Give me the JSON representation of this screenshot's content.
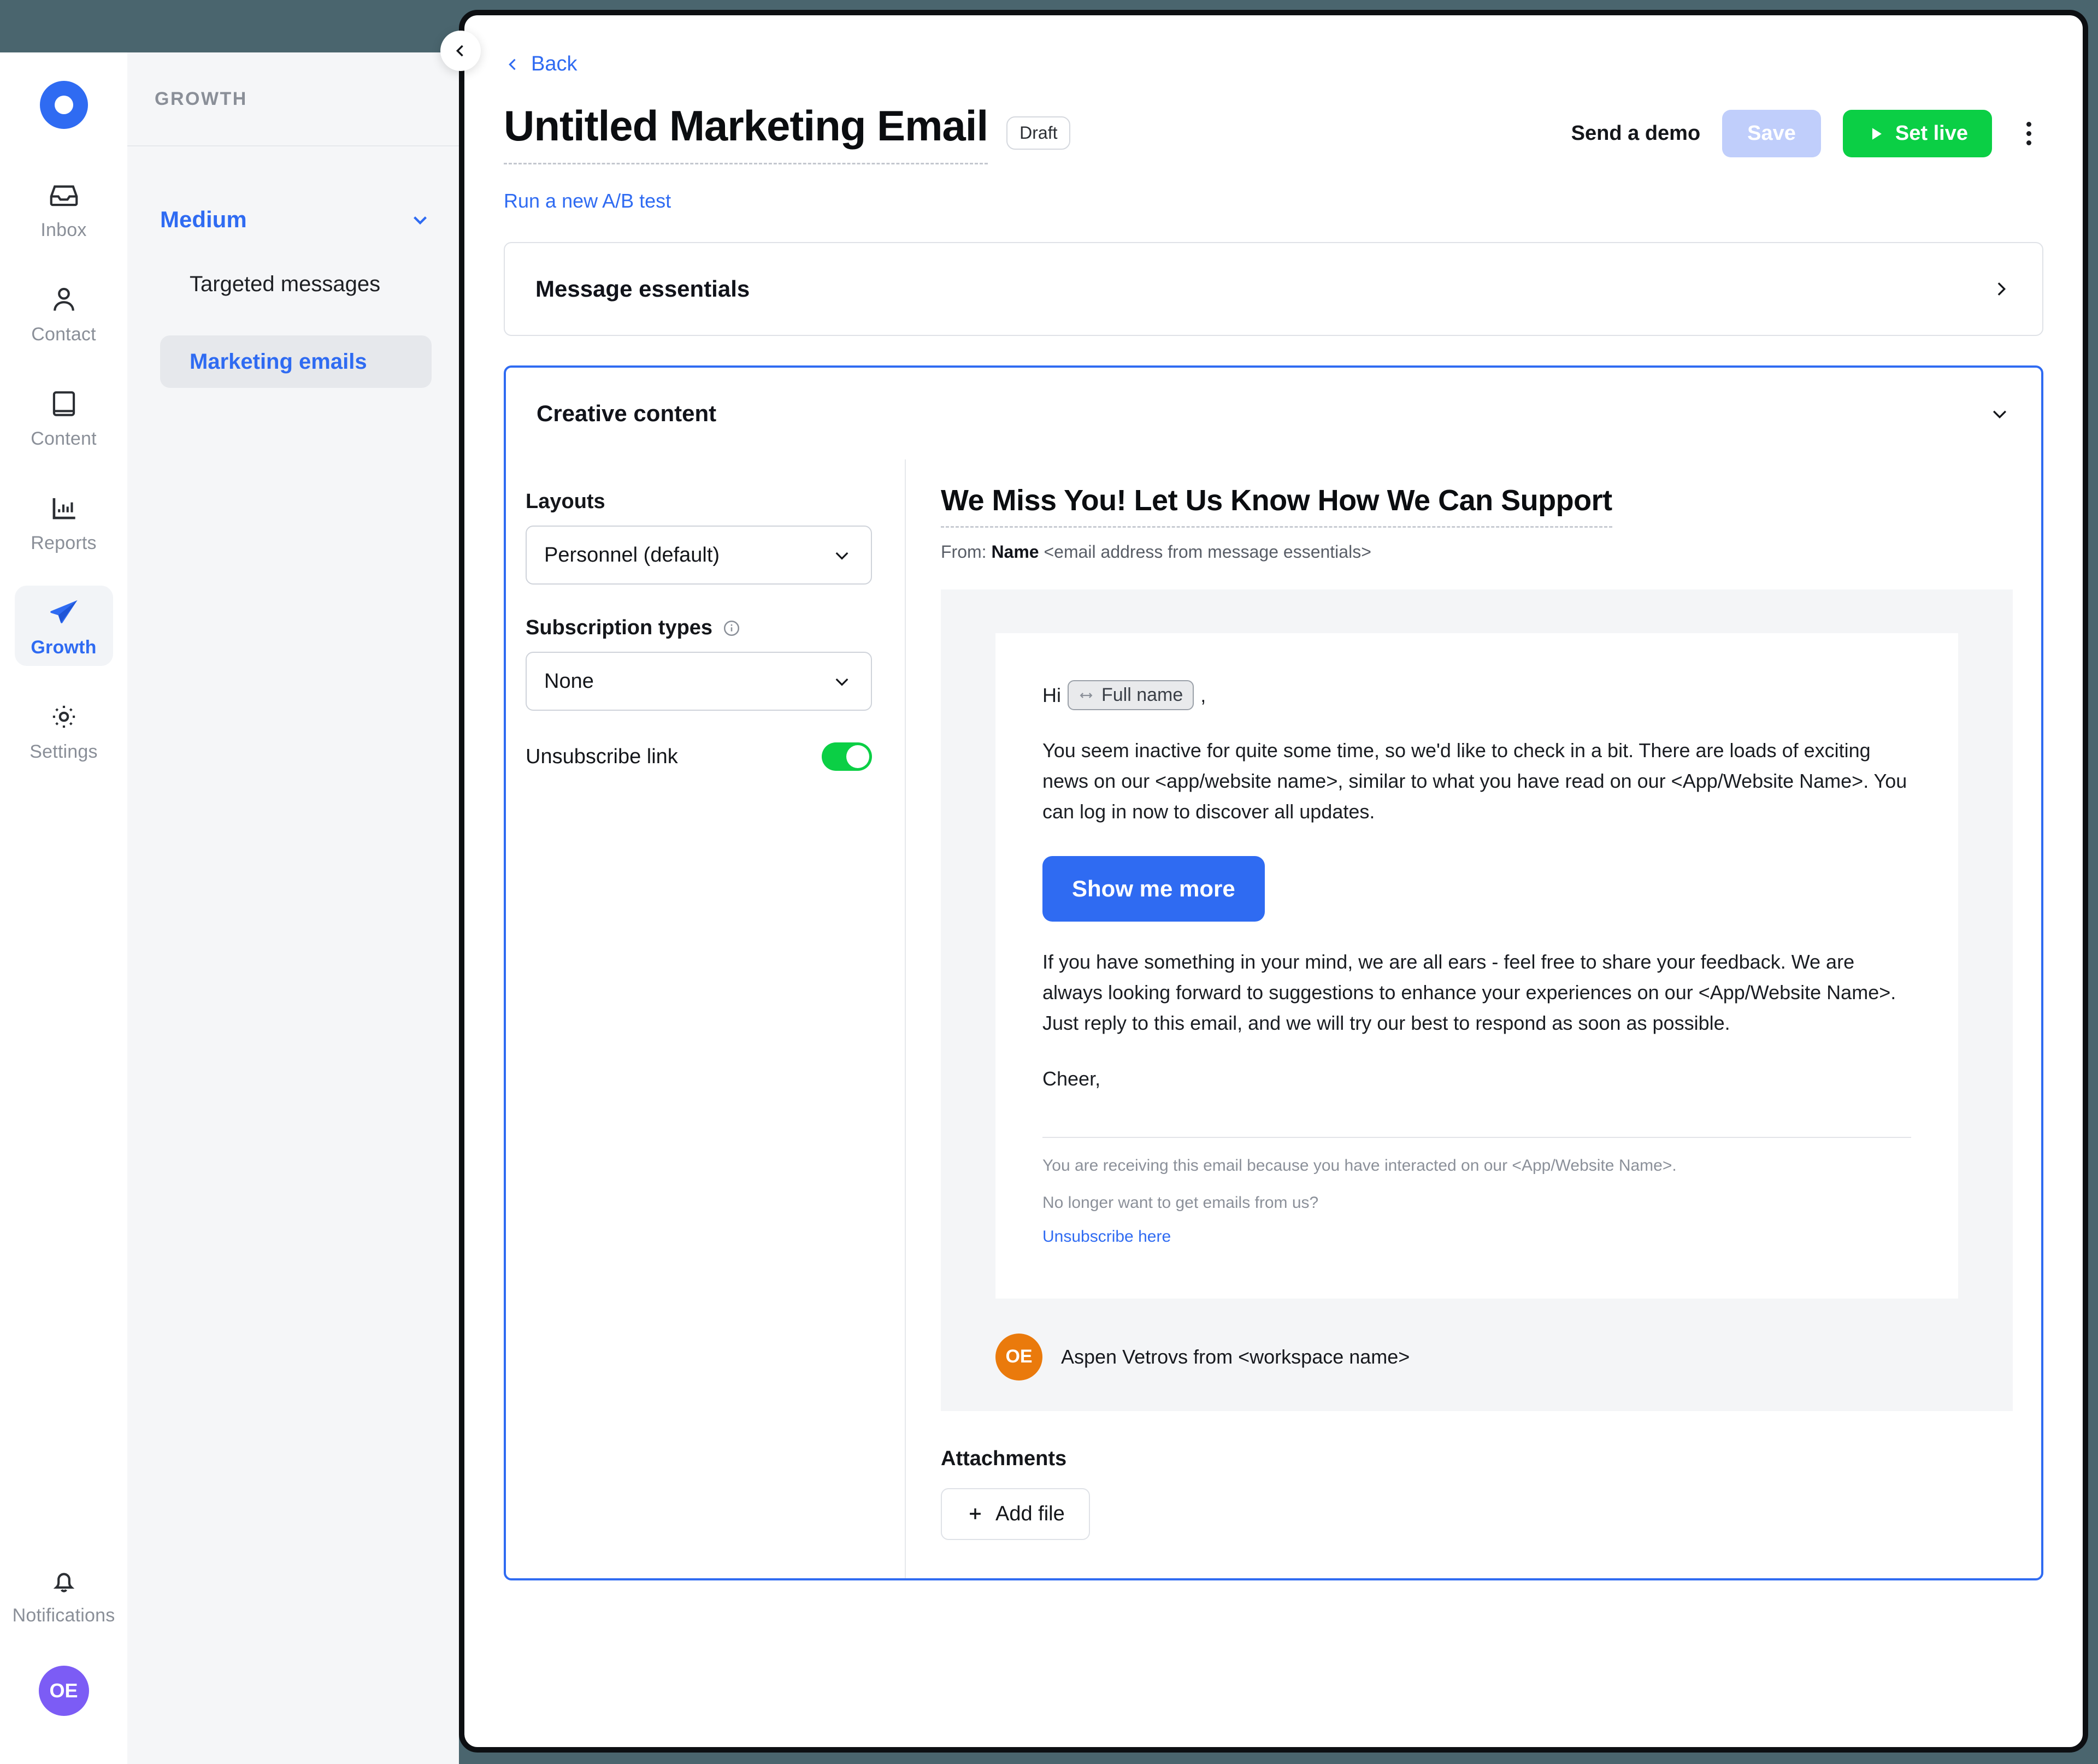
{
  "rail": {
    "logo": "brand-logo",
    "items": [
      {
        "label": "Inbox",
        "icon": "inbox-icon"
      },
      {
        "label": "Contact",
        "icon": "person-icon"
      },
      {
        "label": "Content",
        "icon": "book-icon"
      },
      {
        "label": "Reports",
        "icon": "bar-chart-icon"
      },
      {
        "label": "Growth",
        "icon": "paper-plane-icon"
      },
      {
        "label": "Settings",
        "icon": "gear-icon"
      }
    ],
    "notifications_label": "Notifications",
    "avatar_initials": "OE"
  },
  "sidebar": {
    "header": "GROWTH",
    "group_label": "Medium",
    "items": [
      {
        "label": "Targeted messages"
      },
      {
        "label": "Marketing emails"
      }
    ]
  },
  "header": {
    "back": "Back",
    "title": "Untitled Marketing Email",
    "status_badge": "Draft",
    "send_demo": "Send a demo",
    "save": "Save",
    "set_live": "Set live",
    "ab_test_link": "Run a new A/B test"
  },
  "sections": {
    "message_essentials": "Message essentials",
    "creative_content": "Creative content"
  },
  "controls": {
    "layouts_label": "Layouts",
    "layouts_value": "Personnel (default)",
    "subscription_label": "Subscription types",
    "subscription_value": "None",
    "unsubscribe_label": "Unsubscribe link"
  },
  "preview": {
    "subject": "We Miss You! Let Us Know How We Can Support",
    "from_prefix": "From:",
    "from_name": "Name",
    "from_address": "<email address from message essentials>",
    "greeting_prefix": "Hi",
    "greeting_chip": "Full name",
    "greeting_suffix": ",",
    "paragraph_1": "You seem inactive for quite some time, so we'd like to check in a bit. There are loads of exciting news on our <app/website name>, similar to what you have read on our <App/Website Name>. You can log in now to discover all updates.",
    "cta_label": "Show me more",
    "paragraph_2": "If you have something in your mind, we are all ears - feel free to share your feedback. We are always looking forward to suggestions to enhance your experiences on our <App/Website Name>. Just reply to this email, and we will try our best to respond as soon as possible.",
    "signoff": "Cheer,",
    "footer_line_1": "You are receiving this email because you have interacted on our <App/Website Name>.",
    "footer_line_2": "No longer want to get emails from us?",
    "footer_unsubscribe": "Unsubscribe here",
    "sender_initials": "OE",
    "sender_line": "Aspen Vetrovs from <workspace name>"
  },
  "attachments": {
    "heading": "Attachments",
    "add_file": "Add file"
  },
  "colors": {
    "accent_blue": "#2f6bf2",
    "green": "#0bcf45",
    "save_disabled": "#c0cefb",
    "avatar_purple": "#7c5cf5",
    "sender_orange": "#ea7a0c",
    "frame_teal": "#4a656e"
  }
}
